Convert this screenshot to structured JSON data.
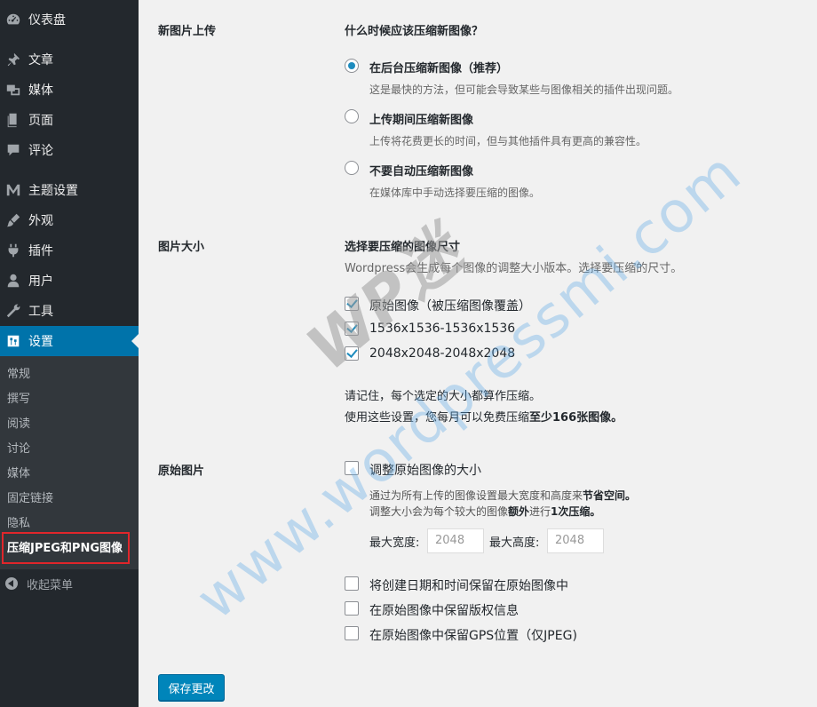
{
  "sidebar": {
    "menu": [
      {
        "label": "仪表盘",
        "icon": "dashboard-icon"
      },
      {
        "label": "文章",
        "icon": "pushpin-icon"
      },
      {
        "label": "媒体",
        "icon": "media-icon"
      },
      {
        "label": "页面",
        "icon": "page-icon"
      },
      {
        "label": "评论",
        "icon": "comment-icon"
      },
      {
        "label": "主题设置",
        "icon": "theme-m-icon"
      },
      {
        "label": "外观",
        "icon": "appearance-icon"
      },
      {
        "label": "插件",
        "icon": "plugin-icon"
      },
      {
        "label": "用户",
        "icon": "user-icon"
      },
      {
        "label": "工具",
        "icon": "wrench-icon"
      },
      {
        "label": "设置",
        "icon": "settings-icon"
      }
    ],
    "submenu": [
      "常规",
      "撰写",
      "阅读",
      "讨论",
      "媒体",
      "固定链接",
      "隐私",
      "压缩JPEG和PNG图像"
    ],
    "collapse_label": "收起菜单"
  },
  "new_upload": {
    "row_label": "新图片上传",
    "heading": "什么时候应该压缩新图像？",
    "options": [
      {
        "label": "在后台压缩新图像（推荐）",
        "desc": "这是最快的方法，但可能会导致某些与图像相关的插件出现问题。",
        "checked": true
      },
      {
        "label": "上传期间压缩新图像",
        "desc": "上传将花费更长的时间，但与其他插件具有更高的兼容性。",
        "checked": false
      },
      {
        "label": "不要自动压缩新图像",
        "desc": "在媒体库中手动选择要压缩的图像。",
        "checked": false
      }
    ]
  },
  "sizes": {
    "row_label": "图片大小",
    "heading": "选择要压缩的图像尺寸",
    "desc": "Wordpress会生成每个图像的调整大小版本。选择要压缩的尺寸。",
    "items": [
      {
        "label": "原始图像（被压缩图像覆盖）",
        "checked": true
      },
      {
        "label": "1536x1536-1536x1536",
        "checked": true
      },
      {
        "label": "2048x2048-2048x2048",
        "checked": true
      }
    ],
    "note1": "请记住，每个选定的大小都算作压缩。",
    "note2_prefix": "使用这些设置，您每月可以免费压缩",
    "note2_bold": "至少166张图像。"
  },
  "original": {
    "row_label": "原始图片",
    "resize_label": "调整原始图像的大小",
    "resize_desc1_prefix": "通过为所有上传的图像设置最大宽度和高度来",
    "resize_desc1_bold": "节省空间。",
    "resize_desc2_prefix": "调整大小会为每个较大的图像",
    "resize_desc2_bold1": "额外",
    "resize_desc2_mid": "进行",
    "resize_desc2_bold2": "1次压缩。",
    "max_width_label": "最大宽度:",
    "max_width_value": "2048",
    "max_height_label": "最大高度:",
    "max_height_value": "2048",
    "preserve": [
      {
        "label": "将创建日期和时间保留在原始图像中",
        "checked": false
      },
      {
        "label": "在原始图像中保留版权信息",
        "checked": false
      },
      {
        "label": "在原始图像中保留GPS位置（仅JPEG)",
        "checked": false
      }
    ]
  },
  "save_label": "保存更改",
  "watermark": {
    "text": "www.wordpressmi.com",
    "logo": "WP迷"
  }
}
